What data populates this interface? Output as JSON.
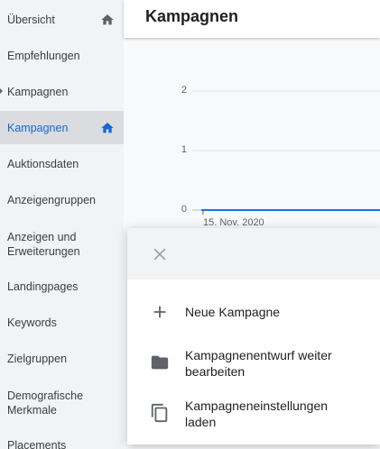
{
  "sidebar": {
    "items": [
      {
        "label": "Übersicht",
        "home": true,
        "active": false
      },
      {
        "label": "Empfehlungen"
      },
      {
        "label": "Kampagnen"
      },
      {
        "label": "Kampagnen",
        "home": true,
        "active": true
      },
      {
        "label": "Auktionsdaten"
      },
      {
        "label": "Anzeigengruppen"
      },
      {
        "label": "Anzeigen und Erweiterungen"
      },
      {
        "label": "Landingpages"
      },
      {
        "label": "Keywords"
      },
      {
        "label": "Zielgruppen"
      },
      {
        "label": "Demografische Merkmale"
      },
      {
        "label": "Placements"
      }
    ]
  },
  "header": {
    "title": "Kampagnen"
  },
  "chart_data": {
    "type": "line",
    "y_ticks": [
      "2",
      "1",
      "0"
    ],
    "ylim": [
      0,
      2
    ],
    "x_tick_label": "15. Nov. 2020",
    "series": [
      {
        "values": [
          0,
          0
        ]
      }
    ],
    "color": "#1a73e8"
  },
  "modal": {
    "options": [
      {
        "label": "Neue Kampagne",
        "icon": "plus-icon"
      },
      {
        "label": "Kampagnenentwurf weiter bearbeiten",
        "icon": "folder-icon"
      },
      {
        "label": "Kampagneneinstellungen laden",
        "icon": "copy-icon"
      }
    ]
  },
  "colors": {
    "accent": "#1967d2",
    "line": "#1a73e8"
  }
}
